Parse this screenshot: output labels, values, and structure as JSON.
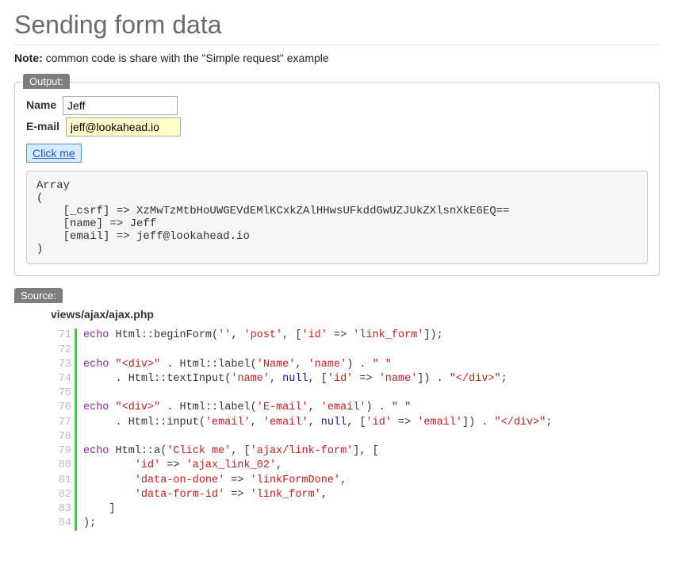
{
  "page_title": "Sending form data",
  "note_label": "Note:",
  "note_text": " common code is share with the \"Simple request\" example",
  "output": {
    "legend": "Output:",
    "name_label": "Name",
    "name_value": "Jeff",
    "email_label": "E-mail",
    "email_value": "jeff@lookahead.io",
    "button_label": "Click me",
    "result_pre": "Array\n(\n    [_csrf] => XzMwTzMtbHoUWGEVdEMlKCxkZAlHHwsUFkddGwUZJUkZXlsnXkE6EQ==\n    [name] => Jeff\n    [email] => jeff@lookahead.io\n)"
  },
  "source": {
    "legend": "Source:",
    "file_path": "views/ajax/ajax.php",
    "lines": [
      {
        "n": 71,
        "tokens": [
          [
            "kw",
            "echo"
          ],
          [
            "plain",
            " Html::"
          ],
          [
            "plain",
            "beginForm("
          ],
          [
            "str",
            "''"
          ],
          [
            "plain",
            ", "
          ],
          [
            "str",
            "'post'"
          ],
          [
            "plain",
            ", ["
          ],
          [
            "str",
            "'id'"
          ],
          [
            "plain",
            " => "
          ],
          [
            "str",
            "'link_form'"
          ],
          [
            "plain",
            "]);"
          ]
        ]
      },
      {
        "n": 72,
        "tokens": []
      },
      {
        "n": 73,
        "tokens": [
          [
            "kw",
            "echo"
          ],
          [
            "plain",
            " "
          ],
          [
            "str",
            "\"<div>\""
          ],
          [
            "plain",
            " . Html::label("
          ],
          [
            "str",
            "'Name'"
          ],
          [
            "plain",
            ", "
          ],
          [
            "str",
            "'name'"
          ],
          [
            "plain",
            ") . "
          ],
          [
            "str",
            "\" \""
          ]
        ]
      },
      {
        "n": 74,
        "tokens": [
          [
            "plain",
            "     . Html::textInput("
          ],
          [
            "str",
            "'name'"
          ],
          [
            "plain",
            ", "
          ],
          [
            "null",
            "null"
          ],
          [
            "plain",
            ", ["
          ],
          [
            "str",
            "'id'"
          ],
          [
            "plain",
            " => "
          ],
          [
            "str",
            "'name'"
          ],
          [
            "plain",
            "]) . "
          ],
          [
            "str",
            "\"</div>\""
          ],
          [
            "plain",
            ";"
          ]
        ]
      },
      {
        "n": 75,
        "tokens": []
      },
      {
        "n": 76,
        "tokens": [
          [
            "kw",
            "echo"
          ],
          [
            "plain",
            " "
          ],
          [
            "str",
            "\"<div>\""
          ],
          [
            "plain",
            " . Html::label("
          ],
          [
            "str",
            "'E-mail'"
          ],
          [
            "plain",
            ", "
          ],
          [
            "str",
            "'email'"
          ],
          [
            "plain",
            ") . "
          ],
          [
            "str",
            "\" \""
          ]
        ]
      },
      {
        "n": 77,
        "tokens": [
          [
            "plain",
            "     . Html::input("
          ],
          [
            "str",
            "'email'"
          ],
          [
            "plain",
            ", "
          ],
          [
            "str",
            "'email'"
          ],
          [
            "plain",
            ", "
          ],
          [
            "null",
            "null"
          ],
          [
            "plain",
            ", ["
          ],
          [
            "str",
            "'id'"
          ],
          [
            "plain",
            " => "
          ],
          [
            "str",
            "'email'"
          ],
          [
            "plain",
            "]) . "
          ],
          [
            "str",
            "\"</div>\""
          ],
          [
            "plain",
            ";"
          ]
        ]
      },
      {
        "n": 78,
        "tokens": []
      },
      {
        "n": 79,
        "tokens": [
          [
            "kw",
            "echo"
          ],
          [
            "plain",
            " Html::a("
          ],
          [
            "str",
            "'Click me'"
          ],
          [
            "plain",
            ", ["
          ],
          [
            "str",
            "'ajax/link-form'"
          ],
          [
            "plain",
            "], ["
          ]
        ]
      },
      {
        "n": 80,
        "tokens": [
          [
            "plain",
            "        "
          ],
          [
            "str",
            "'id'"
          ],
          [
            "plain",
            " => "
          ],
          [
            "str",
            "'ajax_link_02'"
          ],
          [
            "plain",
            ","
          ]
        ]
      },
      {
        "n": 81,
        "tokens": [
          [
            "plain",
            "        "
          ],
          [
            "str",
            "'data-on-done'"
          ],
          [
            "plain",
            " => "
          ],
          [
            "str",
            "'linkFormDone'"
          ],
          [
            "plain",
            ","
          ]
        ]
      },
      {
        "n": 82,
        "tokens": [
          [
            "plain",
            "        "
          ],
          [
            "str",
            "'data-form-id'"
          ],
          [
            "plain",
            " => "
          ],
          [
            "str",
            "'link_form'"
          ],
          [
            "plain",
            ","
          ]
        ]
      },
      {
        "n": 83,
        "tokens": [
          [
            "plain",
            "    ]"
          ]
        ]
      },
      {
        "n": 84,
        "tokens": [
          [
            "plain",
            ");"
          ]
        ]
      }
    ]
  }
}
